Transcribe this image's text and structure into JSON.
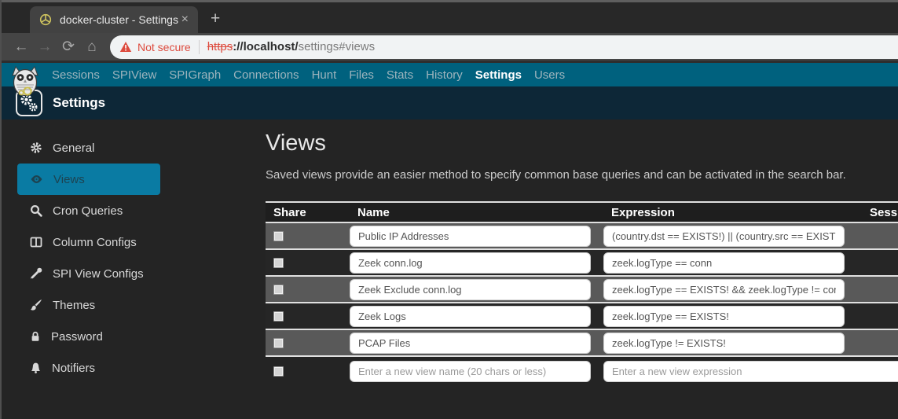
{
  "browser": {
    "tab": {
      "title": "docker-cluster - Settings",
      "close_glyph": "×",
      "new_tab_glyph": "+"
    },
    "toolbar": {
      "back_glyph": "←",
      "forward_glyph": "→",
      "reload_glyph": "⟳",
      "home_glyph": "⌂"
    },
    "urlbar": {
      "warning_label": "Not secure",
      "scheme": "https",
      "host": "://localhost/",
      "path": "settings#views"
    }
  },
  "navbar": {
    "items": [
      {
        "label": "Sessions"
      },
      {
        "label": "SPIView"
      },
      {
        "label": "SPIGraph"
      },
      {
        "label": "Connections"
      },
      {
        "label": "Hunt"
      },
      {
        "label": "Files"
      },
      {
        "label": "Stats"
      },
      {
        "label": "History"
      },
      {
        "label": "Settings",
        "active": true
      },
      {
        "label": "Users"
      }
    ]
  },
  "header": {
    "title": "Settings"
  },
  "sidebar": {
    "items": [
      {
        "icon": "gear-icon",
        "label": "General"
      },
      {
        "icon": "eye-icon",
        "label": "Views",
        "active": true
      },
      {
        "icon": "search-icon",
        "label": "Cron Queries"
      },
      {
        "icon": "columns-icon",
        "label": "Column Configs"
      },
      {
        "icon": "eyedropper-icon",
        "label": "SPI View Configs"
      },
      {
        "icon": "paintbrush-icon",
        "label": "Themes"
      },
      {
        "icon": "lock-icon",
        "label": "Password"
      },
      {
        "icon": "bell-icon",
        "label": "Notifiers"
      }
    ]
  },
  "main": {
    "title": "Views",
    "description": "Saved views provide an easier method to specify common base queries and can be activated in the search bar.",
    "table": {
      "headers": [
        "Share",
        "Name",
        "Expression",
        "Sessions"
      ],
      "rows": [
        {
          "shared": false,
          "name": "Public IP Addresses",
          "expression": "(country.dst == EXISTS!) || (country.src == EXISTS!)"
        },
        {
          "shared": false,
          "name": "Zeek conn.log",
          "expression": "zeek.logType == conn"
        },
        {
          "shared": false,
          "name": "Zeek Exclude conn.log",
          "expression": "zeek.logType == EXISTS! && zeek.logType != conn"
        },
        {
          "shared": false,
          "name": "Zeek Logs",
          "expression": "zeek.logType == EXISTS!"
        },
        {
          "shared": false,
          "name": "PCAP Files",
          "expression": "zeek.logType != EXISTS!"
        }
      ],
      "new_row": {
        "name_placeholder": "Enter a new view name (20 chars or less)",
        "expression_placeholder": "Enter a new view expression"
      }
    }
  },
  "colors": {
    "navbar_teal": "#00617e",
    "subbar_navy": "#0d2737",
    "active_item_teal": "#0a7ba3",
    "warning_red": "#dd4b3e",
    "row_grey": "#595959",
    "row_dark": "#262626"
  }
}
